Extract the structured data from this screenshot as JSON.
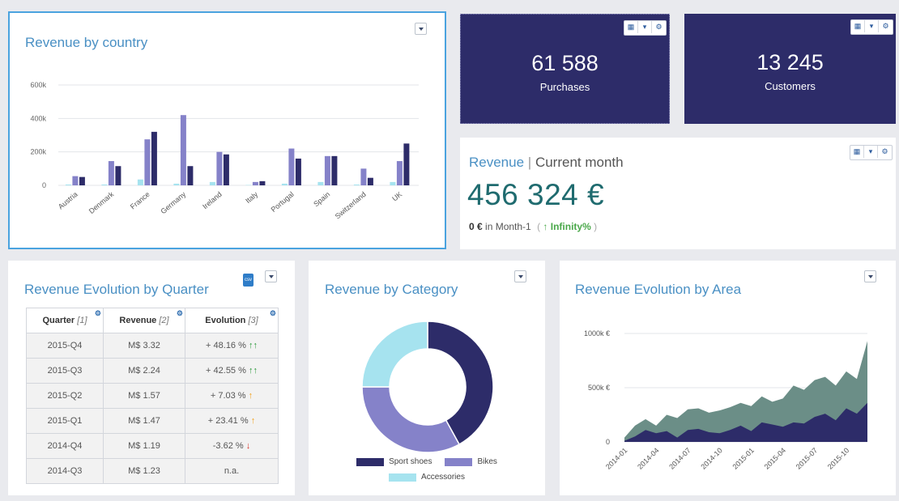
{
  "rev_country": {
    "title": "Revenue by country",
    "y_ticks": [
      "600k",
      "400k",
      "200k",
      "0"
    ],
    "countries": [
      "Austria",
      "Denmark",
      "France",
      "Germany",
      "Ireland",
      "Italy",
      "Portugal",
      "Spain",
      "Switzerland",
      "UK"
    ]
  },
  "kpi_purchases": {
    "value": "61 588",
    "label": "Purchases"
  },
  "kpi_customers": {
    "value": "13 245",
    "label": "Customers"
  },
  "current_month": {
    "title_a": "Revenue",
    "title_sep": "|",
    "title_b": "Current month",
    "value": "456 324 €",
    "prev_value": "0 €",
    "prev_text": "in Month-1",
    "trend_open": "(",
    "trend_arrow": "↑",
    "trend_value": "Infinity%",
    "trend_close": ")"
  },
  "quarter_table": {
    "title": "Revenue Evolution by Quarter",
    "headers": {
      "c1": "Quarter",
      "c1_idx": "[1]",
      "c2": "Revenue",
      "c2_idx": "[2]",
      "c3": "Evolution",
      "c3_idx": "[3]"
    },
    "rows": [
      {
        "q": "2015-Q4",
        "rev": "M$ 3.32",
        "evo": "+ 48.16 %",
        "arrow": "↑↑"
      },
      {
        "q": "2015-Q3",
        "rev": "M$ 2.24",
        "evo": "+ 42.55 %",
        "arrow": "↑↑"
      },
      {
        "q": "2015-Q2",
        "rev": "M$ 1.57",
        "evo": "+ 7.03 %",
        "arrow": "↑"
      },
      {
        "q": "2015-Q1",
        "rev": "M$ 1.47",
        "evo": "+ 23.41 %",
        "arrow": "↑"
      },
      {
        "q": "2014-Q4",
        "rev": "M$ 1.19",
        "evo": "-3.62 %",
        "arrow": "↓"
      },
      {
        "q": "2014-Q3",
        "rev": "M$ 1.23",
        "evo": "n.a.",
        "arrow": ""
      }
    ]
  },
  "category": {
    "title": "Revenue by Category",
    "legend": [
      "Sport shoes",
      "Bikes",
      "Accessories"
    ]
  },
  "area": {
    "title": "Revenue Evolution by Area",
    "y_ticks": [
      "1000k €",
      "500k €",
      "0"
    ],
    "x_ticks": [
      "2014-01",
      "2014-04",
      "2014-07",
      "2014-10",
      "2015-01",
      "2015-04",
      "2015-07",
      "2015-10"
    ]
  },
  "colors": {
    "navy": "#2d2c69",
    "purple": "#8582c9",
    "light": "#a6e3ef",
    "teal": "#6b8e87",
    "blue_title": "#4a90c4"
  },
  "chart_data": [
    {
      "type": "bar",
      "ylim": [
        0,
        600000
      ],
      "categories": [
        "Austria",
        "Denmark",
        "France",
        "Germany",
        "Ireland",
        "Italy",
        "Portugal",
        "Spain",
        "Switzerland",
        "UK"
      ],
      "series": [
        {
          "values": [
            5000,
            5000,
            35000,
            10000,
            20000,
            2000,
            10000,
            20000,
            5000,
            20000
          ]
        },
        {
          "values": [
            55000,
            145000,
            275000,
            420000,
            200000,
            20000,
            220000,
            175000,
            100000,
            145000
          ]
        },
        {
          "values": [
            50000,
            115000,
            320000,
            115000,
            185000,
            25000,
            160000,
            175000,
            45000,
            250000
          ]
        }
      ]
    },
    {
      "type": "pie",
      "series": [
        {
          "name": "Sport shoes",
          "value": 42
        },
        {
          "name": "Bikes",
          "value": 33
        },
        {
          "name": "Accessories",
          "value": 25
        }
      ]
    },
    {
      "type": "area",
      "ylim": [
        0,
        1000000
      ],
      "x": [
        "2014-01",
        "2014-02",
        "2014-03",
        "2014-04",
        "2014-05",
        "2014-06",
        "2014-07",
        "2014-08",
        "2014-09",
        "2014-10",
        "2014-11",
        "2014-12",
        "2015-01",
        "2015-02",
        "2015-03",
        "2015-04",
        "2015-05",
        "2015-06",
        "2015-07",
        "2015-08",
        "2015-09",
        "2015-10",
        "2015-11",
        "2015-12"
      ],
      "series": [
        {
          "values": [
            10000,
            50000,
            110000,
            80000,
            100000,
            40000,
            110000,
            120000,
            90000,
            80000,
            110000,
            150000,
            100000,
            180000,
            160000,
            140000,
            180000,
            170000,
            230000,
            260000,
            200000,
            310000,
            260000,
            360000
          ]
        },
        {
          "values": [
            40000,
            150000,
            210000,
            150000,
            250000,
            220000,
            300000,
            310000,
            270000,
            290000,
            320000,
            360000,
            330000,
            420000,
            370000,
            400000,
            520000,
            480000,
            570000,
            600000,
            520000,
            650000,
            580000,
            930000
          ]
        }
      ]
    }
  ]
}
